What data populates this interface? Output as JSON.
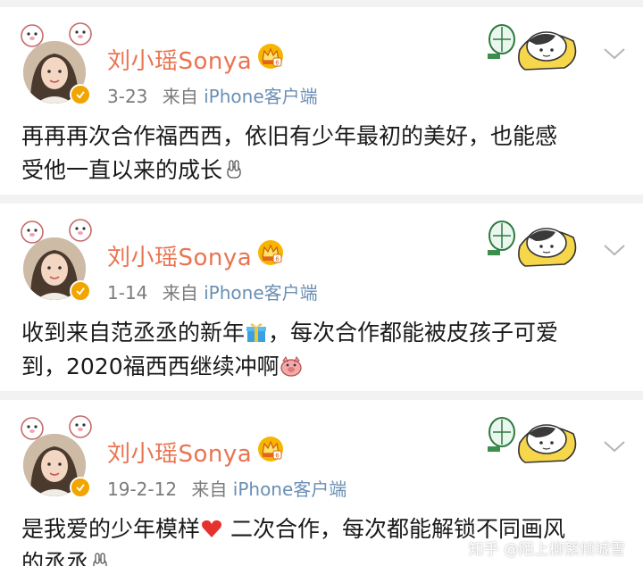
{
  "posts": [
    {
      "username": "刘小瑶Sonya",
      "date": "3-23",
      "source_prefix": "来自",
      "source_device": "iPhone客户端",
      "text_line1": "再再再次合作福西西，依旧有少年最初的美好，也能感",
      "text_line2": "受他一直以来的成长"
    },
    {
      "username": "刘小瑶Sonya",
      "date": "1-14",
      "source_prefix": "来自",
      "source_device": "iPhone客户端",
      "text_line1a": "收到来自范丞丞的新年",
      "text_line1b": "，每次合作都能被皮孩子可爱",
      "text_line2": "到，2020福西西继续冲啊"
    },
    {
      "username": "刘小瑶Sonya",
      "date": "19-2-12",
      "source_prefix": "来自",
      "source_device": "iPhone客户端",
      "text_line1a": "是我爱的少年模样",
      "text_line1b": " 二次合作，每次都能解锁不同画风",
      "text_line2": "的丞丞"
    }
  ],
  "watermark": "知乎 @陌上柳絮倾城雪",
  "icons": {
    "verified": "verified-badge-icon",
    "vip": "crown-vip-icon",
    "menu": "chevron-down-icon",
    "gift": "gift-emoji-icon",
    "heart": "heart-emoji-icon",
    "hand": "yeah-hand-emoji-icon",
    "pig": "pig-emoji-icon"
  },
  "colors": {
    "username": "#eb7350",
    "source": "#6a8fb4",
    "meta": "#7b7b7b",
    "verified": "#f2a400",
    "background": "#f2f2f2"
  }
}
